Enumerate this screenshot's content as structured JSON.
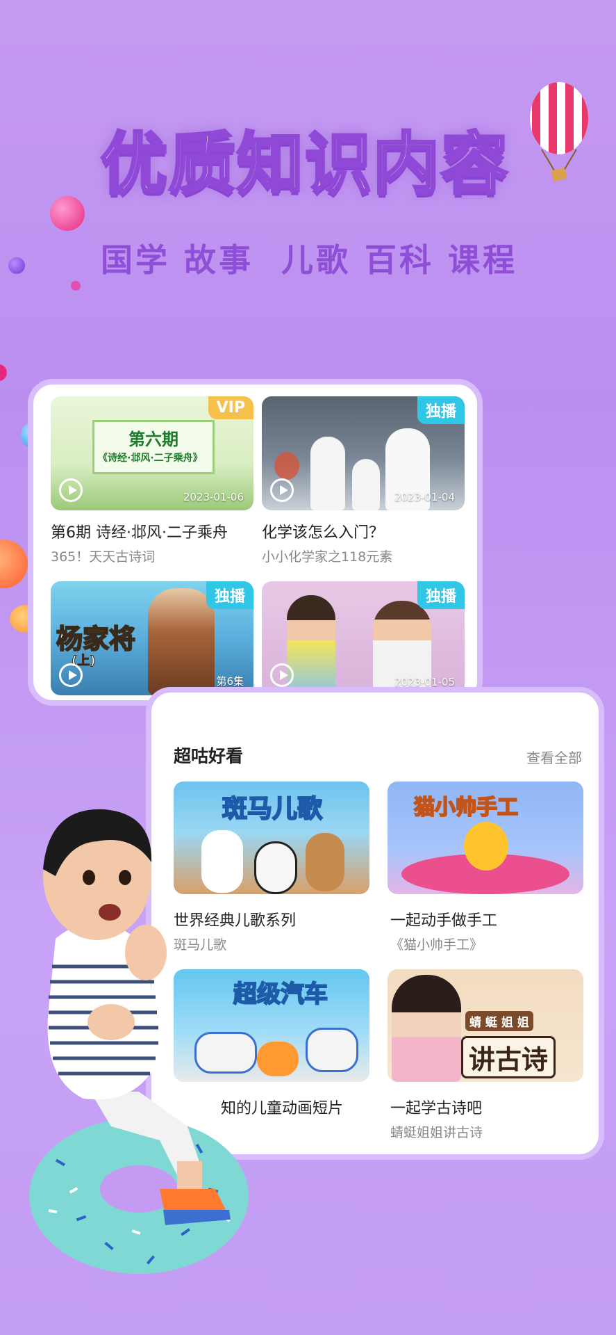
{
  "hero": {
    "title": "优质知识内容",
    "subtitle": "国学 故事  儿歌 百科 课程"
  },
  "top_panel": {
    "cards": [
      {
        "badge": "VIP",
        "badge_type": "vip",
        "date": "2023-01-06",
        "title": "第6期 诗经·邶风·二子乘舟",
        "subtitle": "365！天天古诗词",
        "thumb_text_1": "第六期",
        "thumb_text_2": "《诗经·邶风·二子乘舟》"
      },
      {
        "badge": "独播",
        "badge_type": "excl",
        "date": "2023-01-04",
        "title": "化学该怎么入门？",
        "subtitle": "小小化学家之118元素"
      },
      {
        "badge": "独播",
        "badge_type": "excl",
        "date": "",
        "episode": "第6集",
        "thumb_text_1": "杨家将",
        "thumb_text_2": "(上)"
      },
      {
        "badge": "独播",
        "badge_type": "excl",
        "date": "2023-01-05"
      }
    ]
  },
  "bottom_panel": {
    "section_title": "超咕好看",
    "see_all": "查看全部",
    "cards": [
      {
        "title": "世界经典儿歌系列",
        "subtitle": "斑马儿歌",
        "thumb_text": "斑马儿歌"
      },
      {
        "title": "一起动手做手工",
        "subtitle": "《猫小帅手工》",
        "thumb_text": "猫小帅手工"
      },
      {
        "title": "知的儿童动画短片",
        "subtitle": "",
        "thumb_text": "超级汽车"
      },
      {
        "title": "一起学古诗吧",
        "subtitle": "蜻蜓姐姐讲古诗",
        "thumb_text": "讲古诗",
        "thumb_text_small": "蜻 蜓 姐 姐"
      }
    ]
  },
  "colors": {
    "background": "#c59af2",
    "accent": "#8f4ed6",
    "vip": "#f6c14a",
    "exclusive": "#30c6e6"
  }
}
